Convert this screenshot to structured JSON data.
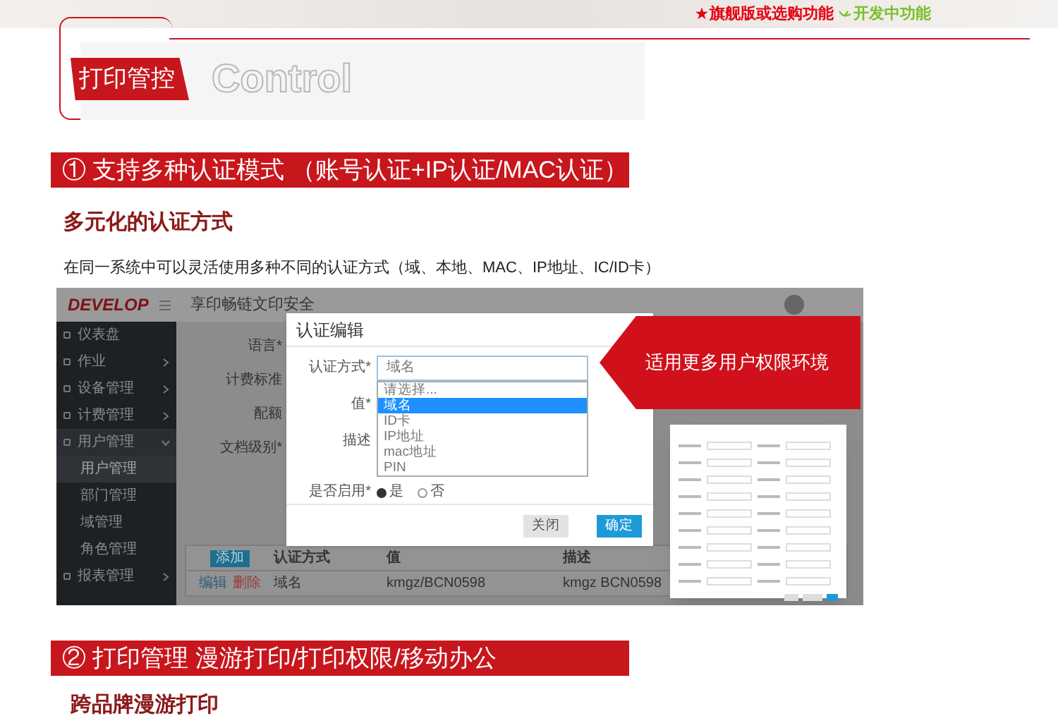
{
  "header": {
    "legend": [
      {
        "kind": "flagship",
        "icon": "★",
        "label": "旗舰版或选购功能"
      },
      {
        "kind": "developing",
        "label": "开发中功能"
      }
    ]
  },
  "chapter": {
    "title": "打印管控",
    "subtitle": "Control"
  },
  "sections": [
    {
      "number": "①",
      "title": "支持多种认证模式 （账号认证+IP认证/MAC认证）",
      "subtitle": "多元化的认证方式",
      "description": "在同一系统中可以灵活使用多种不同的认证方式（域、本地、MAC、IP地址、IC/ID卡）",
      "screenshot": {
        "logo": "DEVELOP",
        "app_title": "享印畅链文印安全",
        "sidebar": [
          {
            "kind": "link",
            "label": "仪表盘",
            "expanded": false
          },
          {
            "kind": "menu",
            "label": "作业",
            "expanded": false
          },
          {
            "kind": "menu",
            "label": "设备管理",
            "expanded": false
          },
          {
            "kind": "menu",
            "label": "计费管理",
            "expanded": false
          },
          {
            "kind": "menu",
            "label": "用户管理",
            "expanded": true,
            "children": [
              {
                "label": "用户管理",
                "selected": true
              },
              {
                "label": "部门管理",
                "selected": false
              },
              {
                "label": "域管理",
                "selected": false
              },
              {
                "label": "角色管理",
                "selected": false
              }
            ]
          },
          {
            "kind": "menu",
            "label": "报表管理",
            "expanded": false
          }
        ],
        "form_labels": [
          "语言*",
          "计费标准",
          "配额",
          "文档级别*"
        ],
        "dialog": {
          "title": "认证编辑",
          "fields": [
            {
              "kind": "select",
              "label": "认证方式*",
              "value": "域名",
              "options": [
                {
                  "label": "请选择...",
                  "selected": false
                },
                {
                  "label": "域名",
                  "selected": true
                },
                {
                  "label": "ID卡",
                  "selected": false
                },
                {
                  "label": "IP地址",
                  "selected": false
                },
                {
                  "label": "mac地址",
                  "selected": false
                },
                {
                  "label": "PIN",
                  "selected": false
                }
              ]
            },
            {
              "kind": "text",
              "label": "值*"
            },
            {
              "kind": "text",
              "label": "描述"
            },
            {
              "kind": "radio",
              "label": "是否启用*",
              "options": [
                {
                  "label": "是",
                  "selected": true
                },
                {
                  "label": "否",
                  "selected": false
                }
              ]
            }
          ],
          "buttons": [
            {
              "kind": "secondary",
              "label": "关闭"
            },
            {
              "kind": "primary",
              "label": "确定"
            }
          ]
        },
        "table": {
          "add_button": "添加",
          "columns": [
            "认证方式",
            "值",
            "描述"
          ],
          "rows": [
            {
              "actions": [
                {
                  "kind": "edit",
                  "label": "编辑"
                },
                {
                  "kind": "delete",
                  "label": "删除"
                }
              ],
              "cells": [
                "域名",
                "kmgz/BCN0598",
                "kmgz BCN0598"
              ]
            }
          ]
        },
        "callout": "适用更多用户权限环境"
      }
    },
    {
      "number": "②",
      "title": "打印管理 漫游打印/打印权限/移动办公",
      "subtitle": "跨品牌漫游打印"
    }
  ]
}
